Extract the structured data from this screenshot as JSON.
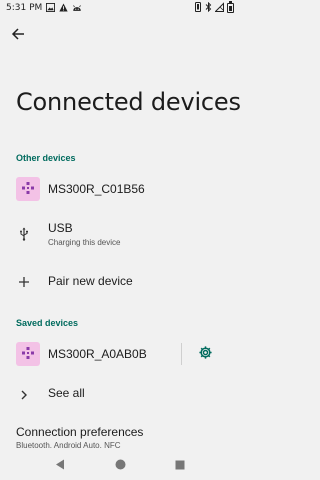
{
  "status_bar": {
    "time": "5:31 PM",
    "left_icons": [
      "image-icon",
      "warning-icon",
      "android-icon"
    ],
    "right_icons": [
      "vibrate-icon",
      "bluetooth-icon",
      "no-signal-icon",
      "battery-icon"
    ]
  },
  "header": {
    "back_icon": "arrow-left-icon",
    "title": "Connected devices"
  },
  "other_devices": {
    "header": "Other devices",
    "items": [
      {
        "title": "MS300R_C01B56",
        "icon": "gamepad-icon"
      },
      {
        "title": "USB",
        "subtitle": "Charging this device",
        "icon": "usb-icon"
      },
      {
        "title": "Pair new device",
        "icon": "plus-icon"
      }
    ]
  },
  "saved_devices": {
    "header": "Saved devices",
    "items": [
      {
        "title": "MS300R_A0AB0B",
        "icon": "gamepad-icon",
        "action_icon": "gear-icon"
      },
      {
        "title": "See all",
        "icon": "chevron-right-icon"
      }
    ]
  },
  "connection_preferences": {
    "title": "Connection preferences",
    "subtitle": "Bluetooth, Android Auto, NFC"
  },
  "colors": {
    "accent": "#006b5e",
    "icon_bg": "#f3c2e6",
    "icon_fg": "#8a3aa8",
    "background": "#f1f1f1"
  },
  "nav_bar": {
    "buttons": [
      "back-triangle-icon",
      "home-circle-icon",
      "recents-square-icon"
    ]
  }
}
